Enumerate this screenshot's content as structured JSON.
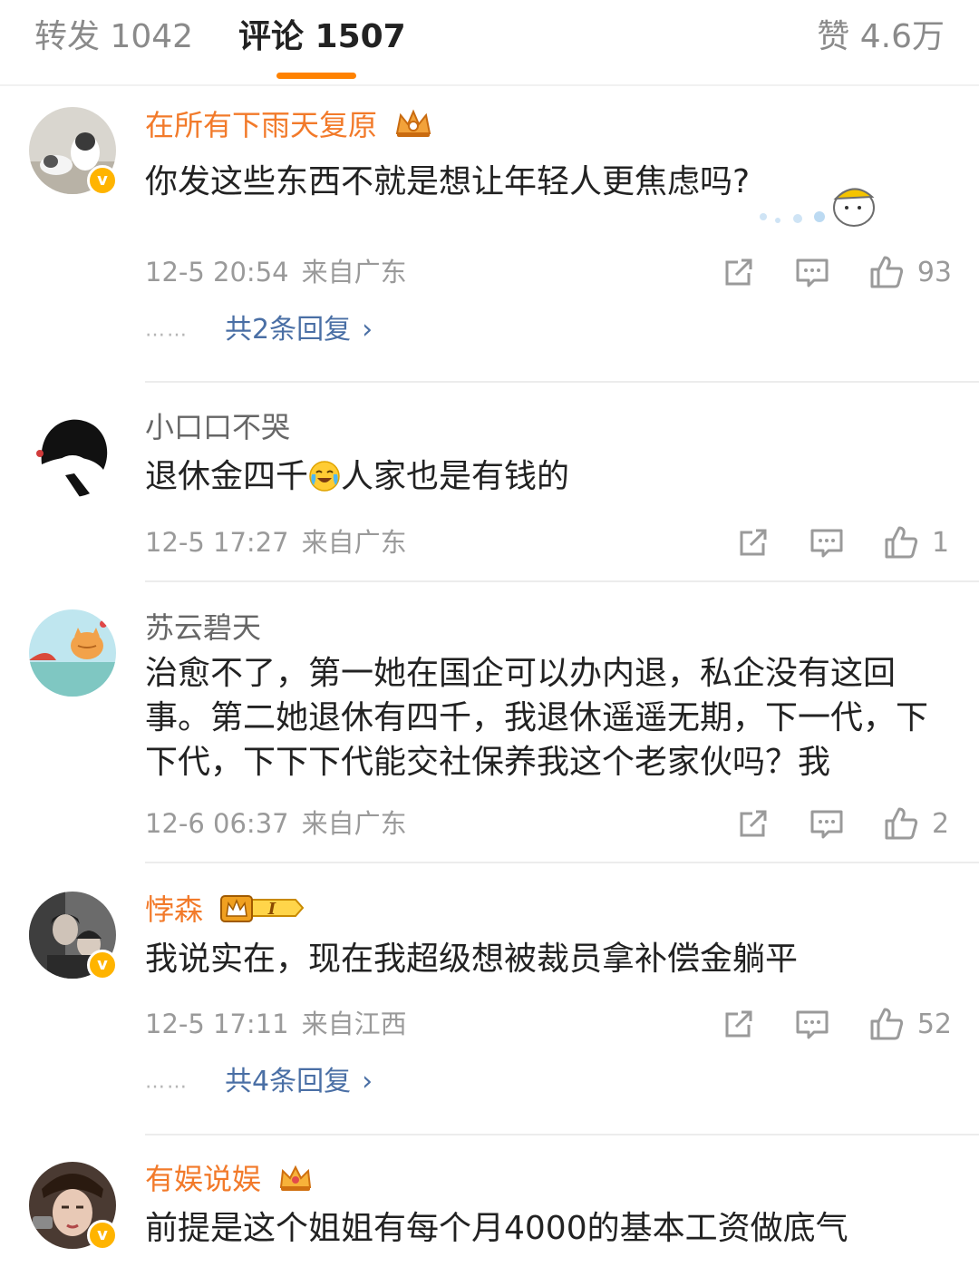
{
  "tabs": {
    "repost": "转发 1042",
    "comments": "评论 1507",
    "likes": "赞 4.6万"
  },
  "colors": {
    "accent": "#ff8200",
    "vip_name": "#f27a2a",
    "link": "#4a6fa5",
    "meta": "#9a9a9a"
  },
  "comments": [
    {
      "username": "在所有下雨天复原",
      "text": "你发这些东西不就是想让年轻人更焦虑吗?",
      "time": "12-5 20:54",
      "location": "来自广东",
      "likes": "93",
      "replies": "共2条回复",
      "verified": true,
      "badge": "crown-icon"
    },
    {
      "username": "小口口不哭",
      "text_before": "退休金四千",
      "text_after": "人家也是有钱的",
      "inline_emoji": "crying-laughing-emoji",
      "time": "12-5 17:27",
      "location": "来自广东",
      "likes": "1"
    },
    {
      "username": "苏云碧天",
      "text": "治愈不了，第一她在国企可以办内退，私企没有这回事。第二她退休有四千，我退休遥遥无期，下一代，下下代，下下下代能交社保养我这个老家伙吗？我",
      "time": "12-6 06:37",
      "location": "来自广东",
      "likes": "2"
    },
    {
      "username": "悖森",
      "text": "我说实在，现在我超级想被裁员拿补偿金躺平",
      "time": "12-5 17:11",
      "location": "来自江西",
      "likes": "52",
      "replies": "共4条回复",
      "verified": true,
      "badge": "vip-level-badge",
      "badge_level": "I"
    },
    {
      "username": "有娱说娱",
      "text": "前提是这个姐姐有每个月4000的基本工资做底气",
      "verified": true,
      "badge": "crown-icon"
    }
  ],
  "icons": {
    "share": "share-icon",
    "comment": "comment-icon",
    "like": "thumbs-up-icon",
    "chevron": "›",
    "dots": "……",
    "verified_mark": "v"
  }
}
